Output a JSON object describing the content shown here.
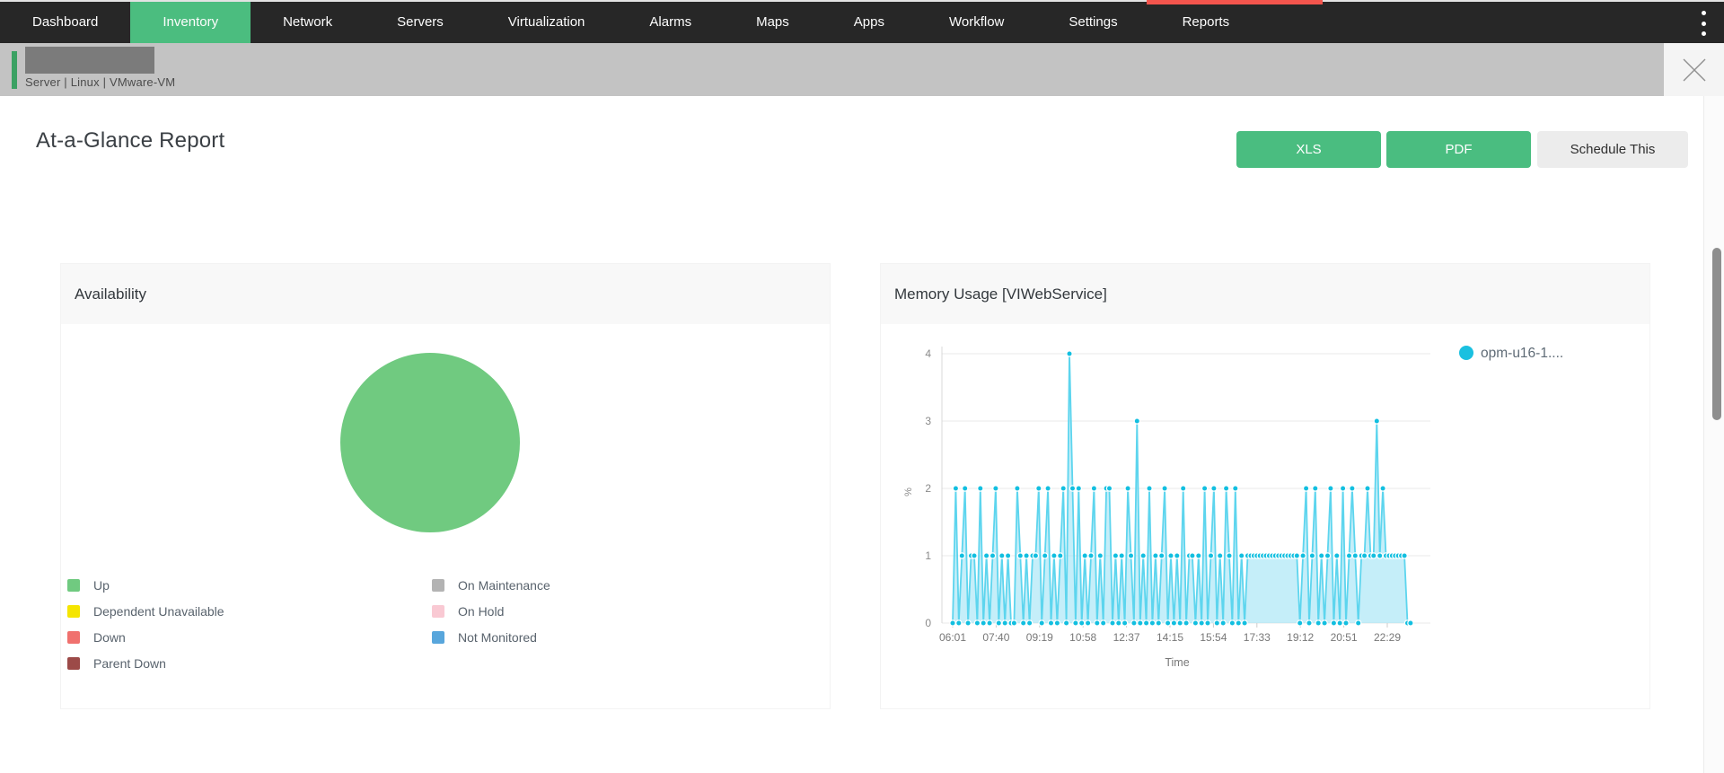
{
  "nav": {
    "items": [
      {
        "label": "Dashboard",
        "active": false
      },
      {
        "label": "Inventory",
        "active": true
      },
      {
        "label": "Network",
        "active": false
      },
      {
        "label": "Servers",
        "active": false
      },
      {
        "label": "Virtualization",
        "active": false
      },
      {
        "label": "Alarms",
        "active": false
      },
      {
        "label": "Maps",
        "active": false
      },
      {
        "label": "Apps",
        "active": false
      },
      {
        "label": "Workflow",
        "active": false
      },
      {
        "label": "Settings",
        "active": false
      },
      {
        "label": "Reports",
        "active": false
      }
    ]
  },
  "notice_bar": {
    "breadcrumb_segments": [
      "Server",
      "Linux",
      "VMware-VM"
    ],
    "separator": " | "
  },
  "report": {
    "title": "At-a-Glance Report",
    "buttons": {
      "xls": "XLS",
      "pdf": "PDF",
      "schedule": "Schedule This"
    }
  },
  "colors": {
    "nav_bg": "#272727",
    "nav_active_green": "#4bbd7f",
    "button_green": "#4abd80",
    "notice_bar_gray": "#c3c3c3",
    "accent_green": "#3ba163",
    "alert_red_strip": "#f4554d",
    "pie_green": "#70ca80",
    "series_cyan_line": "#5dd5ee",
    "series_cyan_marker": "#12bfe0",
    "series_cyan_fill": "rgba(139,221,243,0.5)",
    "legend_dot_cyan": "#1ac0e0"
  },
  "chart_data": [
    {
      "type": "pie",
      "title": "Availability",
      "slices": [
        {
          "label": "Up",
          "value": 100,
          "color": "#70ca80"
        }
      ],
      "legend_columns": [
        [
          {
            "label": "Up",
            "color": "#70ca80"
          },
          {
            "label": "Dependent Unavailable",
            "color": "#f5e500"
          },
          {
            "label": "Down",
            "color": "#f0716e"
          },
          {
            "label": "Parent Down",
            "color": "#9c4a48"
          }
        ],
        [
          {
            "label": "On Maintenance",
            "color": "#b3b3b3"
          },
          {
            "label": "On Hold",
            "color": "#f9c9d3"
          },
          {
            "label": "Not Monitored",
            "color": "#58a6dc"
          }
        ]
      ]
    },
    {
      "type": "area",
      "title": "Memory Usage [VIWebService]",
      "xlabel": "Time",
      "ylabel": "%",
      "ylim": [
        0,
        4
      ],
      "y_ticks": [
        0,
        1,
        2,
        3,
        4
      ],
      "x_tick_labels": [
        "06:01",
        "07:40",
        "09:19",
        "10:58",
        "12:37",
        "14:15",
        "15:54",
        "17:33",
        "19:12",
        "20:51",
        "22:29"
      ],
      "x_tick_interval_min": 99,
      "grid": true,
      "legend_position": "top-right",
      "series": [
        {
          "name": "opm-u16-1....",
          "color": "#12bfe0",
          "x_start_min": 0,
          "x_step_min": 7,
          "values": [
            0,
            2,
            0,
            1,
            2,
            0,
            1,
            1,
            0,
            2,
            0,
            1,
            0,
            1,
            2,
            0,
            1,
            0,
            1,
            0,
            0,
            2,
            1,
            0,
            1,
            0,
            1,
            1,
            2,
            0,
            1,
            2,
            0,
            1,
            0,
            1,
            2,
            0,
            4,
            2,
            0,
            2,
            0,
            1,
            0,
            1,
            2,
            0,
            1,
            0,
            2,
            2,
            0,
            1,
            0,
            1,
            0,
            2,
            1,
            0,
            3,
            0,
            1,
            0,
            2,
            0,
            1,
            0,
            1,
            2,
            0,
            1,
            0,
            1,
            0,
            2,
            0,
            1,
            1,
            0,
            1,
            0,
            2,
            0,
            1,
            2,
            0,
            1,
            0,
            2,
            1,
            0,
            2,
            0,
            1,
            0,
            1,
            1,
            1,
            1,
            1,
            1,
            1,
            1,
            1,
            1,
            1,
            1,
            1,
            1,
            1,
            1,
            1,
            0,
            1,
            2,
            0,
            1,
            2,
            0,
            1,
            0,
            1,
            2,
            0,
            1,
            0,
            2,
            0,
            1,
            2,
            1,
            0,
            1,
            1,
            2,
            1,
            1,
            3,
            1,
            2,
            1,
            1,
            1,
            1,
            1,
            1,
            1,
            0,
            0
          ]
        }
      ]
    }
  ]
}
